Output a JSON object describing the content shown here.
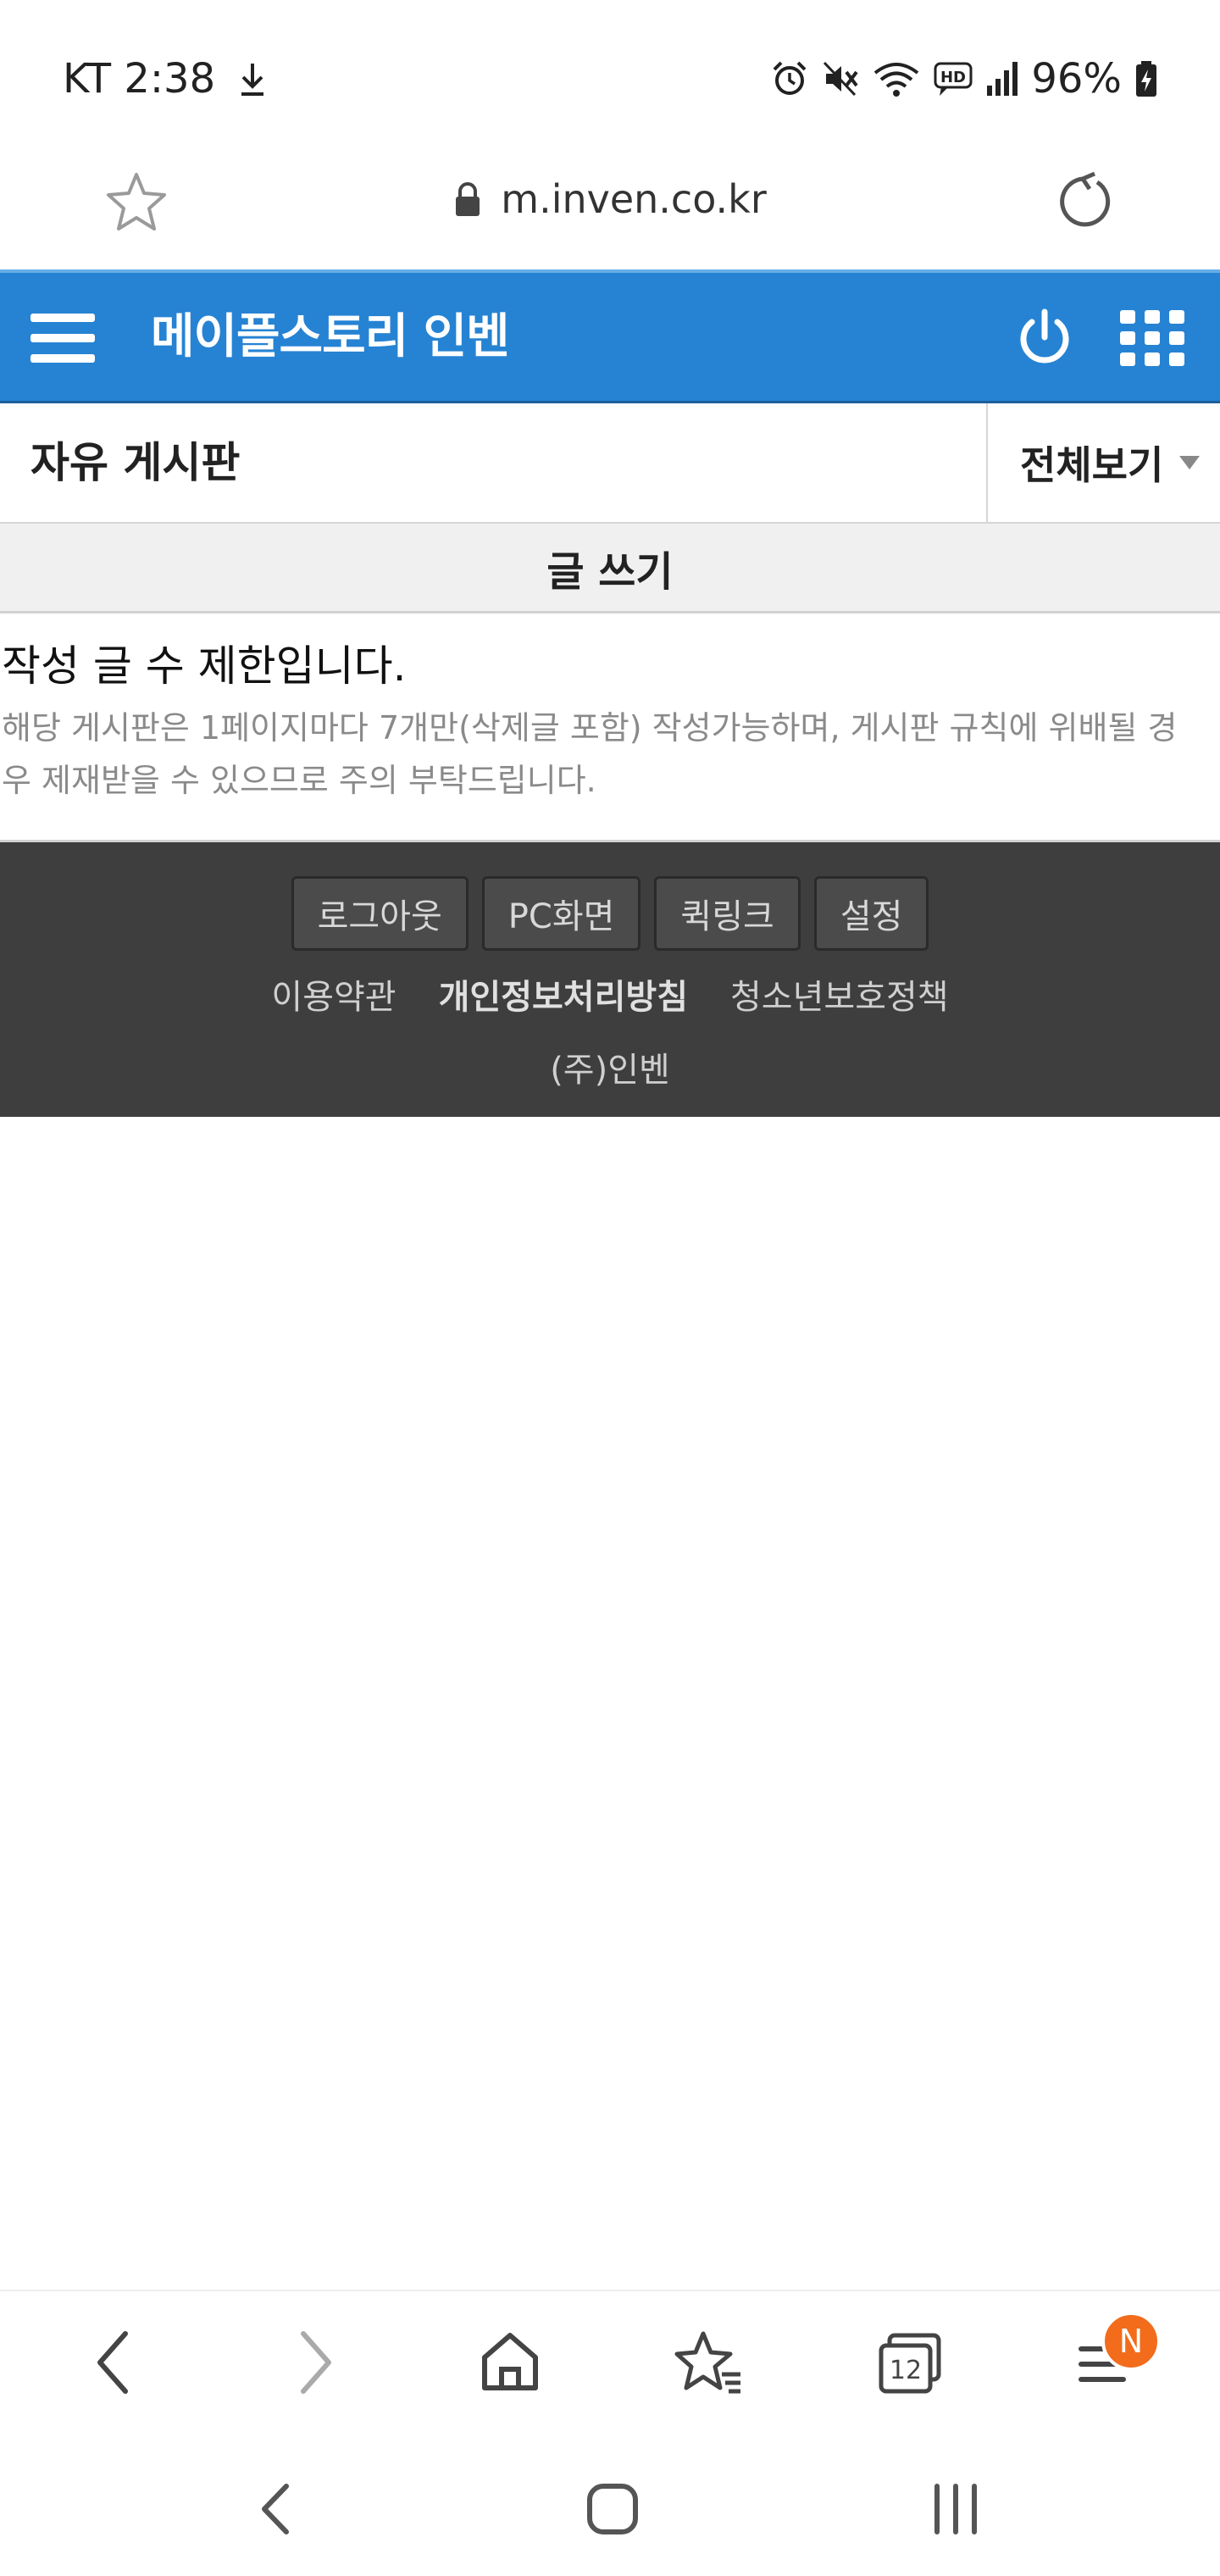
{
  "status_bar": {
    "carrier_time": "KT 2:38",
    "battery": "96%"
  },
  "url_bar": {
    "url": "m.inven.co.kr"
  },
  "site_header": {
    "title": "메이플스토리 인벤"
  },
  "board": {
    "title": "자유 게시판",
    "view_all_label": "전체보기"
  },
  "write": {
    "label": "글 쓰기"
  },
  "notice": {
    "heading": "작성 글 수 제한입니다.",
    "description": "해당 게시판은 1페이지마다 7개만(삭제글 포함) 작성가능하며, 게시판 규칙에 위배될 경우 제재받을 수 있으므로 주의 부탁드립니다."
  },
  "footer": {
    "buttons": [
      "로그아웃",
      "PC화면",
      "퀵링크",
      "설정"
    ],
    "links": [
      "이용약관",
      "개인정보처리방침",
      "청소년보호정책"
    ],
    "corp": "(주)인벤"
  },
  "toolbar": {
    "tabs_count": "12",
    "menu_badge": "N"
  },
  "colors": {
    "header_blue": "#2683d3",
    "footer_dark": "#3e3e3e",
    "badge_orange": "#f26c1c"
  }
}
